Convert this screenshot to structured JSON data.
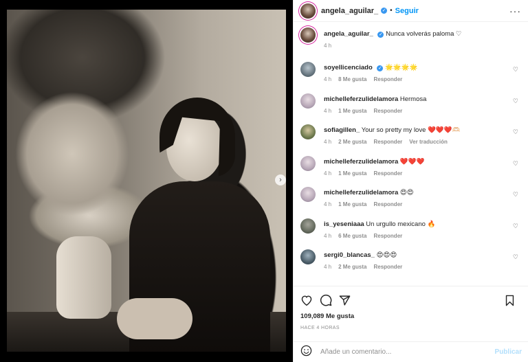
{
  "post": {
    "author": "angela_aguilar_",
    "follow_label": "Seguir",
    "dot": "•",
    "more_icon": "more-horizontal-icon",
    "caption_text": "Nunca volverás paloma ♡",
    "caption_time": "4 h"
  },
  "comments": [
    {
      "user": "soyellicenciado",
      "verified": true,
      "text": "🌟🌟🌟🌟",
      "time": "4 h",
      "likes": "8 Me gusta",
      "reply": "Responder",
      "translate": ""
    },
    {
      "user": "michelleferzulidelamora",
      "verified": false,
      "text": "Hermosa",
      "time": "4 h",
      "likes": "1 Me gusta",
      "reply": "Responder",
      "translate": ""
    },
    {
      "user": "sofiagillen_",
      "verified": false,
      "text": "Your so pretty my love ❤️❤️❤️🫶🏻",
      "time": "4 h",
      "likes": "2 Me gusta",
      "reply": "Responder",
      "translate": "Ver traducción"
    },
    {
      "user": "michelleferzulidelamora",
      "verified": false,
      "text": "❤️❤️❤️",
      "time": "4 h",
      "likes": "1 Me gusta",
      "reply": "Responder",
      "translate": ""
    },
    {
      "user": "michelleferzulidelamora",
      "verified": false,
      "text": "😍😍",
      "time": "4 h",
      "likes": "1 Me gusta",
      "reply": "Responder",
      "translate": ""
    },
    {
      "user": "is_yeseniaaa",
      "verified": false,
      "text": "Un urgullo mexicano 🔥",
      "time": "4 h",
      "likes": "6 Me gusta",
      "reply": "Responder",
      "translate": ""
    },
    {
      "user": "sergi0_blancas_",
      "verified": false,
      "text": "😍😍😍",
      "time": "4 h",
      "likes": "2 Me gusta",
      "reply": "Responder",
      "translate": ""
    }
  ],
  "actions": {
    "likes": "109,089 Me gusta",
    "time": "HACE 4 HORAS"
  },
  "comment_box": {
    "placeholder": "Añade un comentario...",
    "publish": "Publicar"
  },
  "colors": {
    "link": "#0095f6",
    "verified": "#3897f0",
    "publish_disabled": "#b2dffc"
  }
}
